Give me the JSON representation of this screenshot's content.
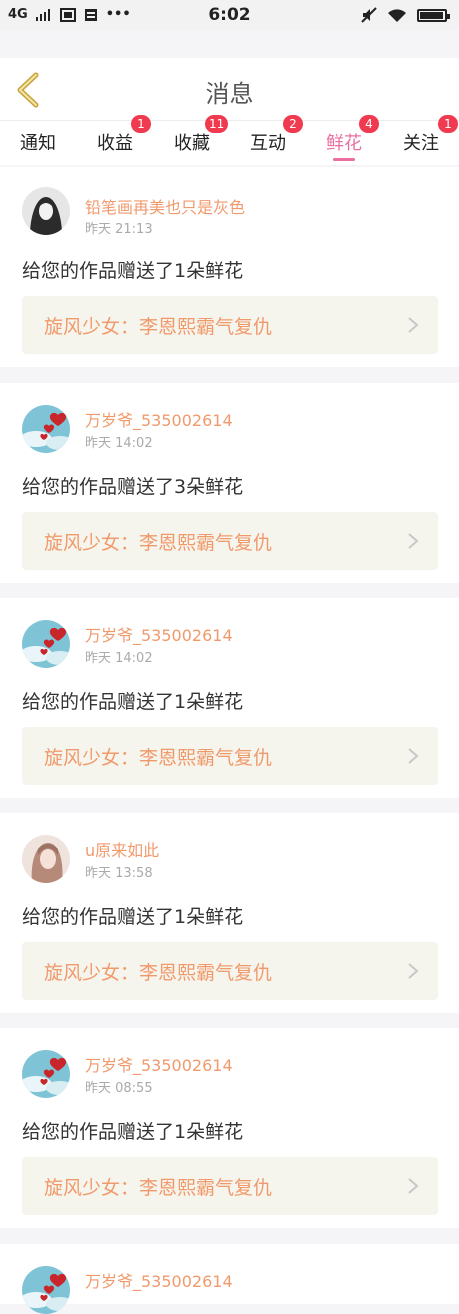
{
  "status_bar": {
    "time": "6:02",
    "network": "4G",
    "icons": [
      "signal-icon",
      "sim-icon",
      "storage-icon",
      "more-dots-icon",
      "mute-icon",
      "wifi-icon",
      "battery-icon"
    ],
    "battery_level": 0.95
  },
  "header": {
    "title": "消息",
    "back_icon": "chevron-left-icon"
  },
  "tabs": [
    {
      "label": "通知",
      "badge": ""
    },
    {
      "label": "收益",
      "badge": "1"
    },
    {
      "label": "收藏",
      "badge": "11"
    },
    {
      "label": "互动",
      "badge": "2"
    },
    {
      "label": "鲜花",
      "badge": "4",
      "active": true
    },
    {
      "label": "关注",
      "badge": "1"
    }
  ],
  "messages": [
    {
      "user": "铅笔画再美也只是灰色",
      "time": "昨天 21:13",
      "text": "给您的作品赠送了1朵鲜花",
      "work": "旋风少女：李恩熙霸气复仇",
      "avatar": "dark-portrait"
    },
    {
      "user": "万岁爷_535002614",
      "time": "昨天 14:02",
      "text": "给您的作品赠送了3朵鲜花",
      "work": "旋风少女：李恩熙霸气复仇",
      "avatar": "hearts"
    },
    {
      "user": "万岁爷_535002614",
      "time": "昨天 14:02",
      "text": "给您的作品赠送了1朵鲜花",
      "work": "旋风少女：李恩熙霸气复仇",
      "avatar": "hearts"
    },
    {
      "user": "u原来如此",
      "time": "昨天 13:58",
      "text": "给您的作品赠送了1朵鲜花",
      "work": "旋风少女：李恩熙霸气复仇",
      "avatar": "girl"
    },
    {
      "user": "万岁爷_535002614",
      "time": "昨天 08:55",
      "text": "给您的作品赠送了1朵鲜花",
      "work": "旋风少女：李恩熙霸气复仇",
      "avatar": "hearts"
    },
    {
      "user": "万岁爷_535002614",
      "time": "",
      "text": "",
      "work": "",
      "avatar": "hearts"
    }
  ],
  "colors": {
    "accent": "#ea6fa0",
    "badge": "#f03a4f",
    "username": "#f09a6c",
    "work_bg": "#f6f5ed",
    "back_icon": "#c9a23a"
  }
}
